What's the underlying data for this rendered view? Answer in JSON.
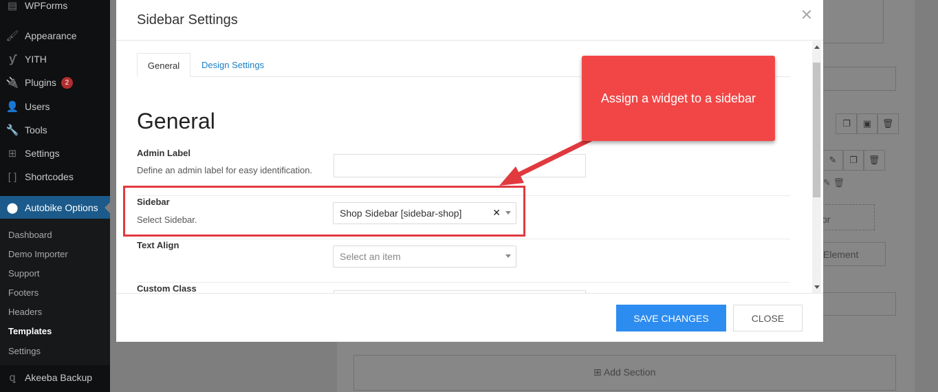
{
  "sidebar": {
    "items": [
      {
        "icon": "forms-icon",
        "label": "WPForms"
      },
      {
        "icon": "paintbrush-icon",
        "label": "Appearance"
      },
      {
        "icon": "yith-icon",
        "label": "YITH"
      },
      {
        "icon": "plug-icon",
        "label": "Plugins",
        "badge": "2"
      },
      {
        "icon": "user-icon",
        "label": "Users"
      },
      {
        "icon": "wrench-icon",
        "label": "Tools"
      },
      {
        "icon": "sliders-icon",
        "label": "Settings"
      },
      {
        "icon": "brackets-icon",
        "label": "Shortcodes"
      },
      {
        "icon": "gear-logo-icon",
        "label": "Autobike Options",
        "current": true
      },
      {
        "icon": "akeeba-icon",
        "label": "Akeeba Backup"
      }
    ],
    "submenu": [
      {
        "label": "Dashboard"
      },
      {
        "label": "Demo Importer"
      },
      {
        "label": "Support"
      },
      {
        "label": "Footers"
      },
      {
        "label": "Headers"
      },
      {
        "label": "Templates",
        "active": true
      },
      {
        "label": "Settings"
      }
    ]
  },
  "background": {
    "element_label": "Element",
    "or_fragment": "or",
    "add_section_label": "Add Section"
  },
  "modal": {
    "title": "Sidebar Settings",
    "tabs": [
      {
        "label": "General",
        "active": true
      },
      {
        "label": "Design Settings"
      }
    ],
    "section_heading": "General",
    "fields": {
      "admin_label": {
        "label": "Admin Label",
        "description": "Define an admin label for easy identification.",
        "value": ""
      },
      "sidebar": {
        "label": "Sidebar",
        "description": "Select Sidebar.",
        "value": "Shop Sidebar [sidebar-shop]"
      },
      "text_align": {
        "label": "Text Align",
        "placeholder": "Select an item"
      },
      "custom_class": {
        "label": "Custom Class"
      }
    },
    "buttons": {
      "save": "SAVE CHANGES",
      "close": "CLOSE"
    }
  },
  "annotation": {
    "callout_text": "Assign a widget to a sidebar",
    "color": "#f24646"
  }
}
